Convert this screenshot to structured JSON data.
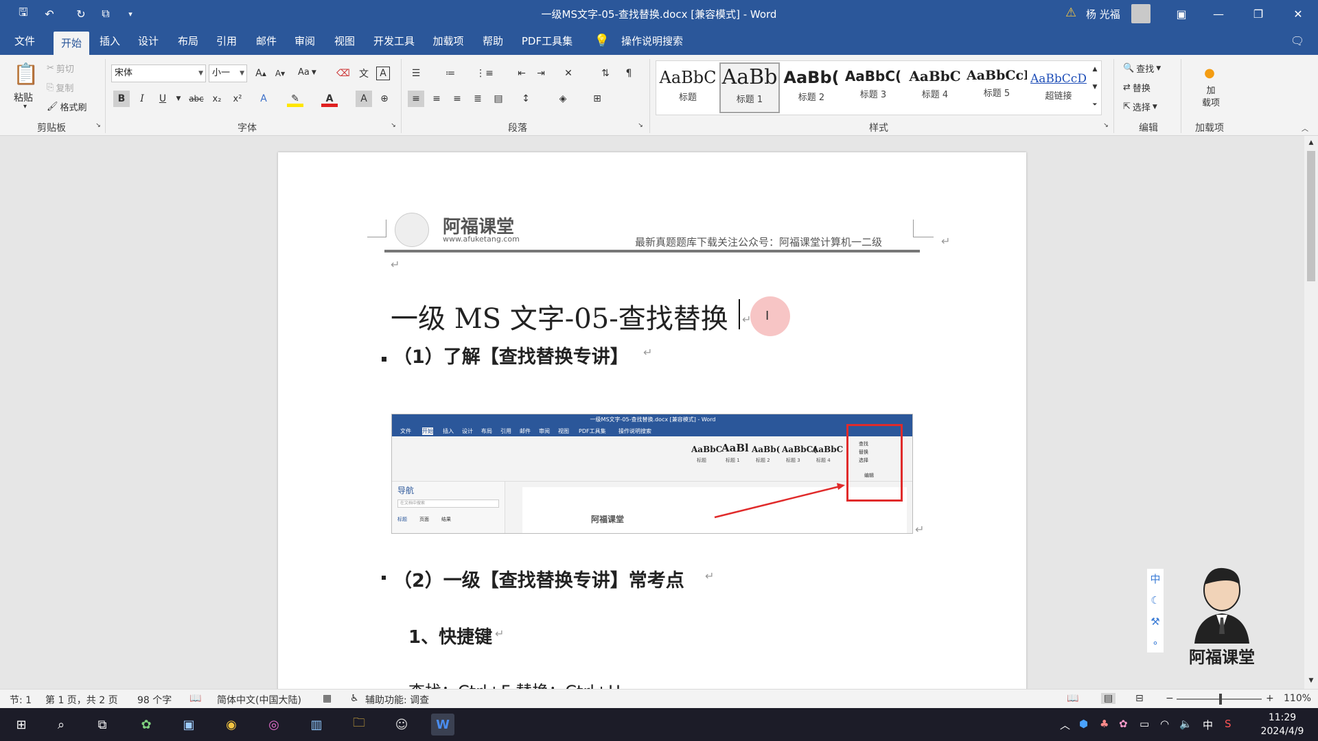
{
  "window": {
    "title": "一级MS文字-05-查找替换.docx [兼容模式] - Word",
    "user": "杨 光福"
  },
  "menubar": {
    "items": [
      "文件",
      "开始",
      "插入",
      "设计",
      "布局",
      "引用",
      "邮件",
      "审阅",
      "视图",
      "开发工具",
      "加载项",
      "帮助",
      "PDF工具集"
    ],
    "active": "开始",
    "tell_me": "操作说明搜索"
  },
  "ribbon": {
    "clipboard": {
      "paste": "粘贴",
      "cut": "剪切",
      "copy": "复制",
      "format_painter": "格式刷",
      "label": "剪贴板"
    },
    "font": {
      "family": "宋体",
      "size": "小一",
      "label": "字体",
      "aa": "Aa"
    },
    "paragraph": {
      "label": "段落"
    },
    "styles": {
      "label": "样式",
      "items": [
        {
          "sample": "AaBbC",
          "name": "标题"
        },
        {
          "sample": "AaBb",
          "name": "标题 1"
        },
        {
          "sample": "AaBb(",
          "name": "标题 2"
        },
        {
          "sample": "AaBbC(",
          "name": "标题 3"
        },
        {
          "sample": "AaBbC",
          "name": "标题 4"
        },
        {
          "sample": "AaBbCcI",
          "name": "标题 5"
        },
        {
          "sample": "AaBbCcD",
          "name": "超链接"
        }
      ]
    },
    "editing": {
      "find": "查找",
      "replace": "替换",
      "select": "选择",
      "label": "编辑"
    },
    "addins": {
      "btn": "加\n载项",
      "label": "加载项"
    }
  },
  "document": {
    "header_brand": "阿福课堂",
    "header_url": "www.afuketang.com",
    "header_note": "最新真题题库下载关注公众号：阿福课堂计算机一二级",
    "title": "一级 MS 文字-05-查找替换",
    "h2_1": "（1）了解【查找替换专讲】",
    "h2_2": "（2）一级【查找替换专讲】常考点",
    "h3_1": "1、快捷键",
    "line1": "查找：Ctrl+F 替换：Ctrl+H",
    "embedded": {
      "title": "一级MS文字-05-查找替换.docx [兼容模式] - Word",
      "menu": [
        "文件",
        "开始",
        "插入",
        "设计",
        "布局",
        "引用",
        "邮件",
        "审阅",
        "视图",
        "PDF工具集",
        "操作说明搜索"
      ],
      "styles": [
        "AaBbC",
        "AaBl",
        "AaBb(",
        "AaBbC(",
        "AaBbC"
      ],
      "style_names": [
        "标题",
        "标题 1",
        "标题 2",
        "标题 3",
        "标题 4"
      ],
      "nav_title": "导航",
      "nav_search": "在文档中搜索",
      "nav_tabs": [
        "标题",
        "页面",
        "结果"
      ],
      "edit": [
        "查找",
        "替换",
        "选择",
        "编辑"
      ],
      "brand": "阿福课堂"
    }
  },
  "floating_logo": {
    "text": "阿福课堂"
  },
  "ime_toolbar": [
    "中",
    "☾",
    "⚒",
    "∘"
  ],
  "status": {
    "section": "节: 1",
    "page": "第 1 页，共 2 页",
    "words": "98 个字",
    "lang": "简体中文(中国大陆)",
    "accessibility": "辅助功能: 调查",
    "zoom": "110%"
  },
  "taskbar": {
    "time": "11:29",
    "date": "2024/4/9",
    "ime": "中"
  }
}
